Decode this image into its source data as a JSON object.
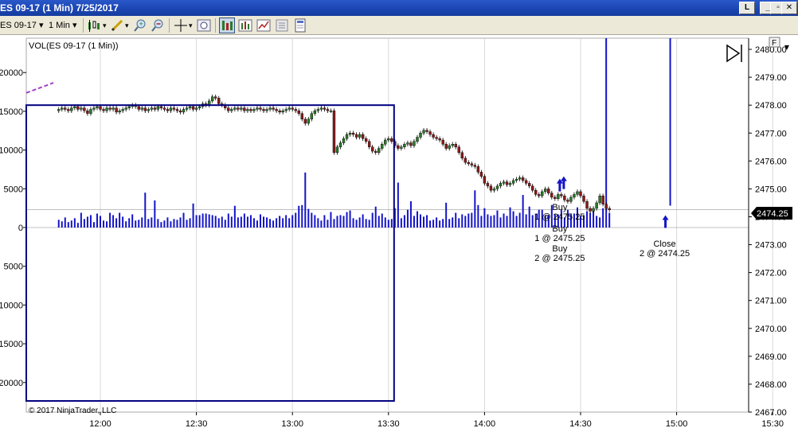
{
  "window": {
    "title": "ES 09-17 (1 Min)  7/25/2017",
    "buttons": {
      "restore_small": "L",
      "minimize": "_",
      "maximize": "▫",
      "close": "✕"
    }
  },
  "toolbar": {
    "instrument": "ES 09-17",
    "interval": "1 Min",
    "icons": [
      "bar-type-icon",
      "draw-tool-icon",
      "zoom-in-icon",
      "zoom-out-icon",
      "crosshair-icon",
      "magnify-icon",
      "chart-trader-icon",
      "indicators-icon",
      "strategies-icon",
      "properties-icon",
      "data-box-icon"
    ]
  },
  "chart": {
    "indicator_label": "VOL(ES 09-17 (1 Min))",
    "copyright": "© 2017 NinjaTrader, LLC",
    "right_axis_letter": "F",
    "last_price_label": "2474.25",
    "colors": {
      "volume": "#1414c8",
      "up_candle": "#2a7a2a",
      "down_candle": "#8b1a1a",
      "rectangle": "#000080",
      "grid": "#d8d8d8",
      "drawn_line": "#a040c8"
    },
    "executions": [
      {
        "lines": [
          "Buy",
          "1 @ 2475.25"
        ]
      },
      {
        "lines": [
          "Buy",
          "1 @ 2475.25"
        ]
      },
      {
        "lines": [
          "Buy",
          "2 @ 2475.25"
        ]
      },
      {
        "lines": [
          "Close",
          "2 @ 2474.25"
        ]
      }
    ]
  },
  "chart_data": {
    "type": "bar",
    "title": "",
    "x_ticks": [
      "12:00",
      "12:30",
      "13:00",
      "13:30",
      "14:00",
      "14:30",
      "15:00",
      "15:30"
    ],
    "price_ticks": [
      "2480.00",
      "2479.00",
      "2478.00",
      "2477.00",
      "2476.00",
      "2475.00",
      "2474.00",
      "2473.00",
      "2472.00",
      "2471.00",
      "2470.00",
      "2469.00",
      "2468.00",
      "2467.00"
    ],
    "volume_ticks": [
      "20000",
      "15000",
      "10000",
      "5000",
      "0",
      "5000",
      "10000",
      "15000",
      "20000"
    ],
    "price_ylim": [
      2467,
      2480.4
    ],
    "volume_ylim": [
      -23000,
      24500
    ],
    "last_price": 2474.25,
    "session_start": "11:47",
    "series": [
      {
        "name": "Price",
        "values": [
          2477.85,
          2477.9,
          2477.85,
          2477.8,
          2477.9,
          2477.95,
          2477.85,
          2477.9,
          2477.8,
          2477.7,
          2477.85,
          2477.9,
          2477.95,
          2477.85,
          2477.8,
          2477.9,
          2477.85,
          2477.9,
          2477.75,
          2477.8,
          2477.85,
          2477.9,
          2477.95,
          2478.0,
          2477.95,
          2477.85,
          2477.9,
          2477.8,
          2477.85,
          2477.9,
          2477.85,
          2477.95,
          2477.9,
          2477.85,
          2477.8,
          2477.9,
          2477.85,
          2477.8,
          2477.75,
          2477.85,
          2477.9,
          2477.95,
          2477.85,
          2477.9,
          2477.95,
          2478.05,
          2478.0,
          2478.15,
          2478.3,
          2478.25,
          2478.05,
          2478.0,
          2477.9,
          2477.8,
          2477.85,
          2477.9,
          2477.85,
          2477.9,
          2477.8,
          2477.85,
          2477.8,
          2477.85,
          2477.9,
          2477.85,
          2477.8,
          2477.85,
          2477.9,
          2477.85,
          2477.8,
          2477.75,
          2477.8,
          2477.85,
          2477.9,
          2477.85,
          2477.8,
          2477.7,
          2477.5,
          2477.35,
          2477.5,
          2477.7,
          2477.8,
          2477.85,
          2477.9,
          2477.85,
          2477.8,
          2477.8,
          2476.3,
          2476.5,
          2476.65,
          2476.8,
          2476.95,
          2477.0,
          2476.95,
          2476.85,
          2476.95,
          2476.8,
          2476.7,
          2476.5,
          2476.35,
          2476.3,
          2476.45,
          2476.6,
          2476.75,
          2476.8,
          2476.7,
          2476.55,
          2476.45,
          2476.5,
          2476.6,
          2476.65,
          2476.55,
          2476.7,
          2476.85,
          2477.0,
          2477.1,
          2477.05,
          2476.95,
          2476.85,
          2476.8,
          2476.75,
          2476.6,
          2476.45,
          2476.55,
          2476.6,
          2476.5,
          2476.3,
          2476.1,
          2475.95,
          2475.9,
          2475.85,
          2475.8,
          2475.6,
          2475.45,
          2475.2,
          2475.1,
          2474.95,
          2475.0,
          2475.1,
          2475.2,
          2475.25,
          2475.15,
          2475.2,
          2475.3,
          2475.35,
          2475.4,
          2475.3,
          2475.2,
          2475.1,
          2474.95,
          2474.8,
          2474.75,
          2474.9,
          2475.0,
          2474.85,
          2474.7,
          2474.65,
          2474.8,
          2474.75,
          2474.6,
          2474.55,
          2474.7,
          2474.8,
          2474.9,
          2474.75,
          2474.55,
          2474.3,
          2474.2,
          2474.3,
          2474.5,
          2474.75,
          2474.45,
          2474.3,
          2474.25
        ]
      },
      {
        "name": "VOL",
        "values": [
          1000,
          800,
          1300,
          700,
          900,
          1200,
          600,
          1900,
          1100,
          1400,
          1600,
          700,
          1800,
          1500,
          900,
          800,
          1900,
          1600,
          1200,
          1900,
          1400,
          800,
          1200,
          1700,
          900,
          1000,
          1300,
          4500,
          1100,
          1300,
          3500,
          1100,
          700,
          900,
          1300,
          800,
          1100,
          1000,
          1300,
          1900,
          1000,
          1200,
          3100,
          1600,
          1600,
          1800,
          1800,
          1700,
          1600,
          1500,
          1200,
          1400,
          1000,
          1800,
          1400,
          2800,
          1300,
          1400,
          1800,
          1400,
          1600,
          1200,
          900,
          1700,
          1400,
          1300,
          1100,
          900,
          1200,
          1500,
          1200,
          1600,
          1200,
          1600,
          1900,
          2800,
          2900,
          7100,
          2400,
          1900,
          1600,
          1200,
          900,
          1600,
          1000,
          2000,
          1100,
          1500,
          1600,
          1500,
          2000,
          2200,
          1200,
          1000,
          1300,
          1700,
          1100,
          1000,
          1900,
          2700,
          1500,
          1800,
          1300,
          1000,
          1100,
          2500,
          5800,
          1200,
          1600,
          2300,
          3400,
          1500,
          2100,
          1700,
          1400,
          1600,
          900,
          1000,
          1300,
          900,
          1100,
          3200,
          1100,
          1300,
          1900,
          1200,
          1700,
          1500,
          1800,
          1900,
          4800,
          2900,
          1500,
          2500,
          1700,
          1500,
          1600,
          2200,
          1300,
          1800,
          1500,
          2600,
          2100,
          1500,
          1900,
          4200,
          1700,
          2700,
          1600,
          1800,
          2300,
          2300,
          1600,
          1600,
          2900,
          1700,
          1700,
          2300,
          1300,
          2300,
          1700,
          1800,
          2600,
          1500,
          1600,
          2100,
          1900,
          2300,
          1500,
          1300,
          2500,
          24500,
          1900
        ]
      }
    ]
  }
}
